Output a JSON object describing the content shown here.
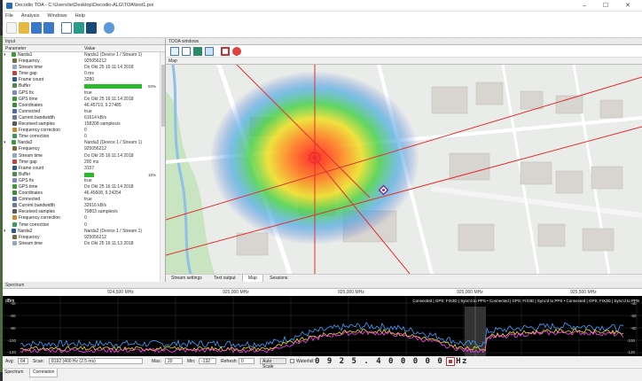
{
  "window": {
    "title": "Decodio TOA - C:\\Users\\te\\Desktop\\Decodio-ALG\\TOA\\test1.poi",
    "minimize": "–",
    "maximize": "☐",
    "close": "✕"
  },
  "menu": [
    "File",
    "Analysis",
    "Windows",
    "Help"
  ],
  "input_panel": {
    "title": "Input",
    "col_parameter": "Parameter",
    "col_value": "Value",
    "rows": [
      {
        "name": "Narda1",
        "value": "Narda1 (Device 1 / Stream 1)",
        "group": true,
        "color": "#3a9a3a"
      },
      {
        "name": "Frequency",
        "value": "925056212",
        "color": "#7a6a3a"
      },
      {
        "name": "Stream time",
        "value": "Do Okt 25 16:11:14 2018",
        "color": "#8fa8c8"
      },
      {
        "name": "Time gap",
        "value": "0 ms",
        "color": "#c84040"
      },
      {
        "name": "Frame count",
        "value": "3280",
        "color": "#2a5a8a"
      },
      {
        "name": "Buffer",
        "value": "",
        "buffer": 0.93,
        "pct": "93%",
        "color": "#4a8a4a"
      },
      {
        "name": "GPS fix",
        "value": "true",
        "color": "#7a8ac8"
      },
      {
        "name": "GPS time",
        "value": "Do Okt 25 16:11:14 2018",
        "color": "#3a9a3a"
      },
      {
        "name": "Coordinates",
        "value": "46.45719, 9.27485",
        "color": "#3a8a3a"
      },
      {
        "name": "Connected",
        "value": "true",
        "color": "#4a6aa8"
      },
      {
        "name": "Current bandwidth",
        "value": "61614 kB/s",
        "color": "#6a7a9a"
      },
      {
        "name": "Received samples",
        "value": "158208 samples/s",
        "color": "#5a5a5a"
      },
      {
        "name": "Frequency correction",
        "value": "0",
        "color": "#c88a2a"
      },
      {
        "name": "Time correction",
        "value": "0",
        "color": "#3a9a5a"
      },
      {
        "name": "Narda3",
        "value": "Narda3 (Device 1 / Stream 1)",
        "group": true,
        "color": "#3a9a3a"
      },
      {
        "name": "Frequency",
        "value": "925056212",
        "color": "#7a6a3a"
      },
      {
        "name": "Stream time",
        "value": "Do Okt 25 16:11:14 2018",
        "color": "#8fa8c8"
      },
      {
        "name": "Time gap",
        "value": "200 ms",
        "color": "#c84040"
      },
      {
        "name": "Frame count",
        "value": "3157",
        "color": "#2a5a8a"
      },
      {
        "name": "Buffer",
        "value": "",
        "buffer": 0.15,
        "pct": "15%",
        "color": "#4a8a4a"
      },
      {
        "name": "GPS fix",
        "value": "true",
        "color": "#7a8ac8"
      },
      {
        "name": "GPS time",
        "value": "Do Okt 25 16:11:14 2018",
        "color": "#3a9a3a"
      },
      {
        "name": "Coordinates",
        "value": "46.45608, 9.24254",
        "color": "#3a8a3a"
      },
      {
        "name": "Connected",
        "value": "true",
        "color": "#4a6aa8"
      },
      {
        "name": "Current bandwidth",
        "value": "32616 kB/s",
        "color": "#6a7a9a"
      },
      {
        "name": "Received samples",
        "value": "79803 samples/s",
        "color": "#5a5a5a"
      },
      {
        "name": "Frequency correction",
        "value": "0",
        "color": "#c88a2a"
      },
      {
        "name": "Time correction",
        "value": "0",
        "color": "#3a9a5a"
      },
      {
        "name": "Narda2",
        "value": "Narda2 (Device 1 / Stream 1)",
        "group": true,
        "color": "#2a5a9a"
      },
      {
        "name": "Frequency",
        "value": "925056212",
        "color": "#7a6a3a"
      },
      {
        "name": "Stream time",
        "value": "Do Okt 25 16:11:13 2018",
        "color": "#8fa8c8"
      }
    ]
  },
  "toa_window": {
    "title": "TDOA windows",
    "map_title": "Map",
    "tabs": [
      "Stream settings",
      "Text output",
      "Map",
      "Sessions"
    ],
    "selected_tab": "Map"
  },
  "spectrum": {
    "title": "Spectrum",
    "freq_labels": [
      "924,500 MHz",
      "925,000 MHz",
      "925,000 MHz",
      "925,000 MHz",
      "925,500 MHz"
    ],
    "db_label": "dBm",
    "ylabels_left": [
      "-40",
      "-60",
      "-80",
      "-100",
      "-120"
    ],
    "ylabels_right": [
      "-40",
      "-60",
      "-80",
      "-100",
      "-120"
    ],
    "status_text": "Connected | GPS: FIX3D | Sync'd to PPS • Connected | GPS: FIX3D | Sync'd to PPS • Connected | GPS: FIX3D | Sync'd to PPS",
    "controls": {
      "avg_label": "Avg:",
      "avg_value": "64",
      "scan_label": "Scan:",
      "scan_value": "8192 (400 Hz (2.5 ms)",
      "max_label": "Max:",
      "max_value": "20",
      "min_label": "Min:",
      "min_value": "-132",
      "refresh_label": "Refresh:",
      "refresh_value": "0",
      "autoscale": "Auto Scale",
      "waterfall": "Waterfall",
      "frequency": "0 9 2 5 . 4 0 0 0 0 0 MHz"
    },
    "tabs": [
      "Spectrum",
      "Correlation"
    ]
  }
}
